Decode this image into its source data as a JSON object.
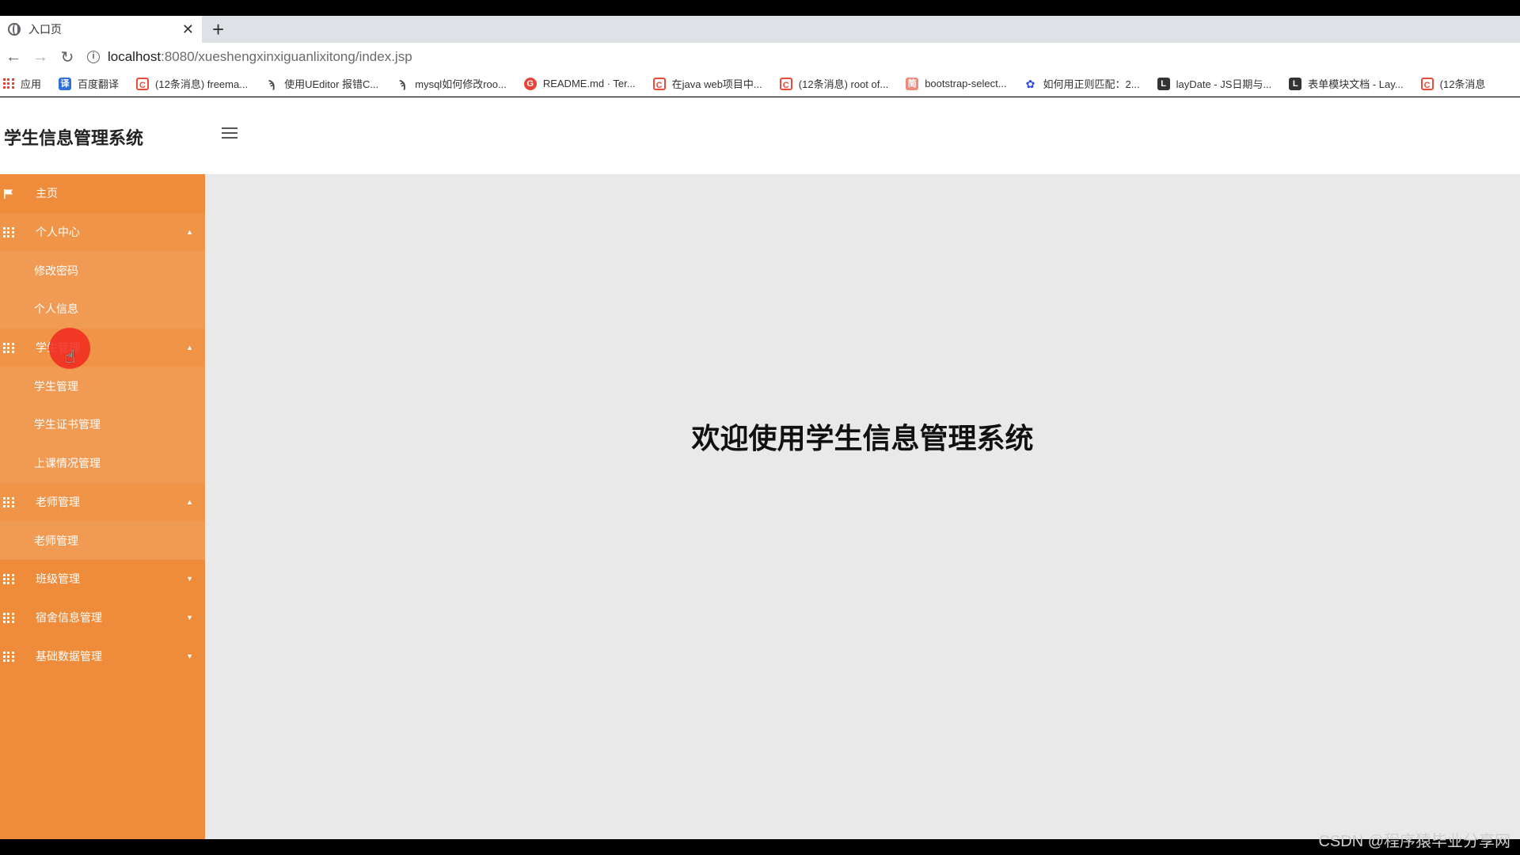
{
  "browser": {
    "tab_title": "入口页",
    "close_glyph": "✕",
    "newtab_glyph": "+",
    "url_host": "localhost",
    "url_path": ":8080/xueshengxinxiguanlixitong/index.jsp",
    "bookmarks": [
      {
        "label": "应用",
        "icon": "apps-grid-icon"
      },
      {
        "label": "百度翻译",
        "icon": "translate-icon",
        "glyph": "译"
      },
      {
        "label": "(12条消息) freema...",
        "icon": "csdn-icon",
        "glyph": "C"
      },
      {
        "label": "使用UEditor 报错C...",
        "icon": "sketch-icon",
        "glyph": "ϡ"
      },
      {
        "label": "mysql如何修改roo...",
        "icon": "sketch-icon",
        "glyph": "ϡ"
      },
      {
        "label": "README.md · Ter...",
        "icon": "gitee-icon",
        "glyph": "G"
      },
      {
        "label": "在java web项目中...",
        "icon": "csdn-icon",
        "glyph": "C"
      },
      {
        "label": "(12条消息) root of...",
        "icon": "csdn-icon",
        "glyph": "C"
      },
      {
        "label": "bootstrap-select...",
        "icon": "jianshu-icon",
        "glyph": "简"
      },
      {
        "label": "如何用正则匹配：2...",
        "icon": "baidu-paw-icon",
        "glyph": "✿"
      },
      {
        "label": "layDate - JS日期与...",
        "icon": "layui-icon",
        "glyph": "L"
      },
      {
        "label": "表单模块文档 - Lay...",
        "icon": "layui-icon",
        "glyph": "L"
      },
      {
        "label": "(12条消息",
        "icon": "csdn-icon",
        "glyph": "C"
      }
    ]
  },
  "app": {
    "title": "学生信息管理系统",
    "welcome": "欢迎使用学生信息管理系统"
  },
  "sidebar": {
    "items": [
      {
        "type": "top",
        "label": "主页",
        "icon": "flag-icon"
      },
      {
        "type": "parent",
        "label": "个人中心",
        "icon": "grid-icon",
        "arrow": "▲"
      },
      {
        "type": "child",
        "label": "修改密码"
      },
      {
        "type": "child",
        "label": "个人信息"
      },
      {
        "type": "parent",
        "label": "学生管理",
        "icon": "grid-icon",
        "arrow": "▲"
      },
      {
        "type": "child",
        "label": "学生管理"
      },
      {
        "type": "child",
        "label": "学生证书管理"
      },
      {
        "type": "child",
        "label": "上课情况管理"
      },
      {
        "type": "parent",
        "label": "老师管理",
        "icon": "grid-icon",
        "arrow": "▲"
      },
      {
        "type": "child",
        "label": "老师管理"
      },
      {
        "type": "top",
        "label": "班级管理",
        "icon": "grid-icon",
        "arrow": "▼"
      },
      {
        "type": "top",
        "label": "宿舍信息管理",
        "icon": "grid-icon",
        "arrow": "▼"
      },
      {
        "type": "top",
        "label": "基础数据管理",
        "icon": "grid-icon",
        "arrow": "▼"
      }
    ]
  },
  "watermark": "CSDN @程序猿毕业分享网",
  "colors": {
    "sidebar": "#ef8c3b",
    "main_bg": "#e9e9e9",
    "cursor_highlight": "#f0281e"
  }
}
